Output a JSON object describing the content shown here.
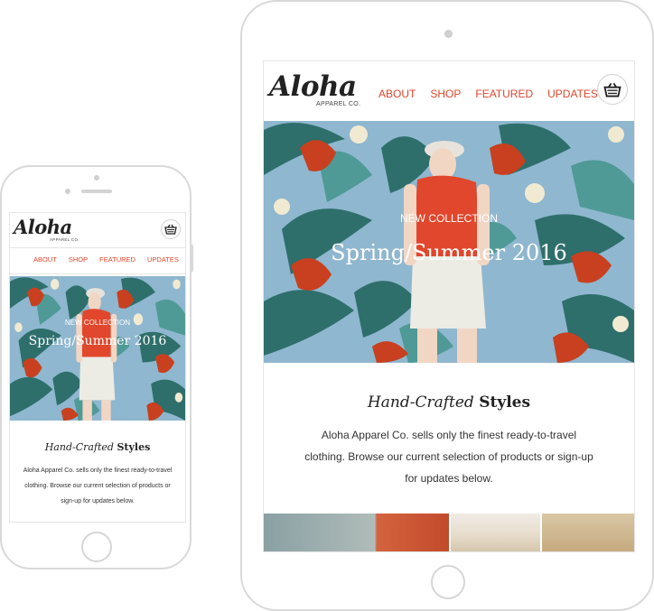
{
  "brand": {
    "logo": "Aloha",
    "tagline": "APPAREL CO."
  },
  "nav": {
    "items": [
      {
        "label": "ABOUT"
      },
      {
        "label": "SHOP"
      },
      {
        "label": "FEATURED"
      },
      {
        "label": "UPDATES"
      }
    ]
  },
  "hero": {
    "eyebrow": "NEW COLLECTION",
    "title": "Spring/Summer 2016"
  },
  "intro": {
    "title_italic": "Hand-Crafted",
    "title_bold": "Styles",
    "text": "Aloha Apparel Co. sells only the finest ready-to-travel clothing. Browse our current selection of products or sign-up for updates below."
  },
  "icons": {
    "cart": "shopping-basket-icon"
  },
  "colors": {
    "accent": "#e0452a",
    "hero_sky": "#8fb7cf",
    "leaf_teal": "#2e6f6c",
    "flower_red": "#c8401f"
  }
}
